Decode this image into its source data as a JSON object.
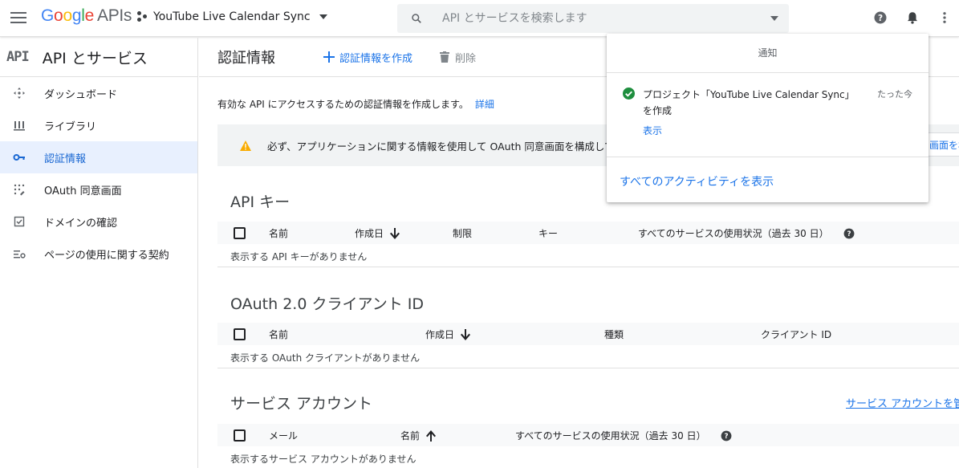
{
  "topbar": {
    "logo_google": "Google",
    "logo_apis": "APIs",
    "project_name": "YouTube Live Calendar Sync",
    "search_placeholder": "API とサービスを検索します"
  },
  "sidebar": {
    "badge": "API",
    "title": "API とサービス",
    "items": [
      {
        "label": "ダッシュボード",
        "icon": "dashboard-icon"
      },
      {
        "label": "ライブラリ",
        "icon": "library-icon"
      },
      {
        "label": "認証情報",
        "icon": "key-icon",
        "active": true
      },
      {
        "label": "OAuth 同意画面",
        "icon": "consent-icon"
      },
      {
        "label": "ドメインの確認",
        "icon": "checkbox-icon"
      },
      {
        "label": "ページの使用に関する契約",
        "icon": "settings-list-icon"
      }
    ]
  },
  "main": {
    "title": "認証情報",
    "create_label": "認証情報を作成",
    "delete_label": "削除",
    "description": "有効な API にアクセスするための認証情報を作成します。",
    "details_link": "詳細",
    "warning": "必ず、アプリケーションに関する情報を使用して OAuth 同意画面を構成してください。",
    "api_keys": {
      "title": "API キー",
      "columns": [
        "名前",
        "作成日",
        "制限",
        "キー",
        "すべてのサービスの使用状況（過去 30 日）"
      ],
      "empty": "表示する API キーがありません"
    },
    "oauth": {
      "title": "OAuth 2.0 クライアント ID",
      "columns": [
        "名前",
        "作成日",
        "種類",
        "クライアント ID"
      ],
      "empty": "表示する OAuth クライアントがありません"
    },
    "service_accounts": {
      "title": "サービス アカウント",
      "manage_link": "サービス アカウントを管理",
      "columns": [
        "メール",
        "名前",
        "すべてのサービスの使用状況（過去 30 日）"
      ],
      "empty": "表示するサービス アカウントがありません"
    },
    "peek_text": "画面を構成"
  },
  "notifications": {
    "title": "通知",
    "item_text_1": "プロジェクト「YouTube Live Calendar Sync」",
    "item_text_2": "を作成",
    "item_time": "たった今",
    "item_view": "表示",
    "view_all": "すべてのアクティビティを表示"
  },
  "colors": {
    "accent": "#1a73e8",
    "success": "#1e8e3e",
    "warning": "#f9ab00",
    "active_bg": "#e8f0fe"
  }
}
